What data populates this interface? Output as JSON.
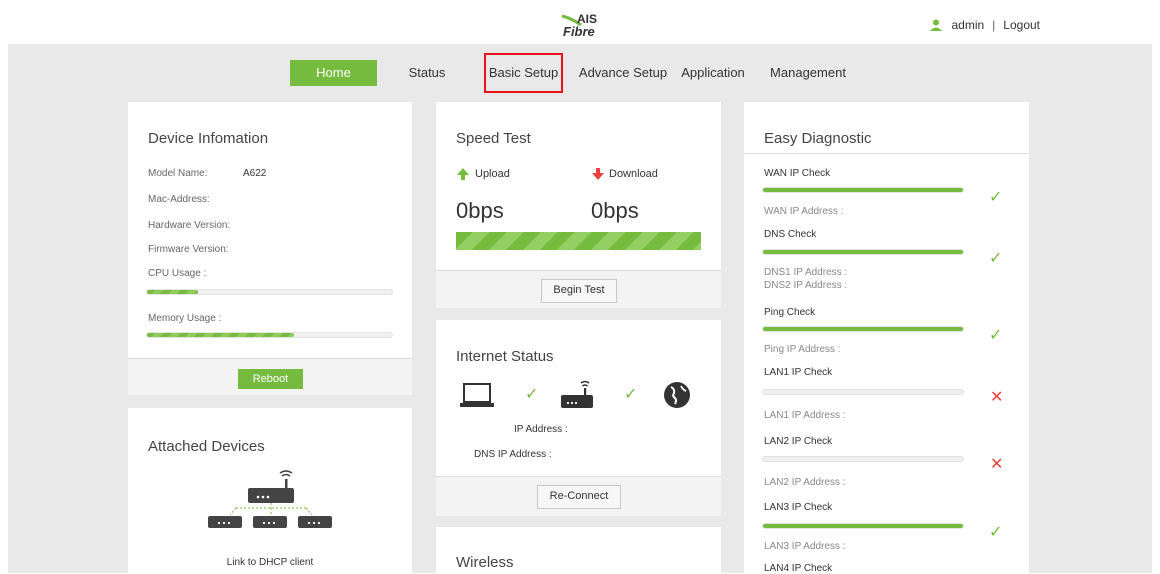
{
  "header": {
    "logo_top": "AIS",
    "logo_bottom": "Fibre",
    "user": "admin",
    "separator": "|",
    "logout": "Logout"
  },
  "nav": {
    "home": "Home",
    "status": "Status",
    "basic_setup": "Basic Setup",
    "advance_setup": "Advance Setup",
    "application": "Application",
    "management": "Management"
  },
  "device_info": {
    "title": "Device Infomation",
    "model_label": "Model Name:",
    "model_value": "A622",
    "mac_label": "Mac-Address:",
    "hw_label": "Hardware Version:",
    "fw_label": "Firmware Version:",
    "cpu_label": "CPU Usage :",
    "cpu_usage": 0.21,
    "mem_label": "Memory Usage :",
    "mem_usage": 0.6,
    "reboot": "Reboot"
  },
  "attached": {
    "title": "Attached Devices",
    "caption": "Link to DHCP client"
  },
  "speed_test": {
    "title": "Speed Test",
    "upload_label": "Upload",
    "download_label": "Download",
    "upload_value": "0bps",
    "download_value": "0bps",
    "begin": "Begin Test"
  },
  "internet_status": {
    "title": "Internet Status",
    "ip_label": "IP Address :",
    "dns_label": "DNS IP Address :",
    "reconnect": "Re-Connect"
  },
  "wireless": {
    "title": "Wireless"
  },
  "diagnostic": {
    "title": "Easy Diagnostic",
    "wan_check": "WAN IP Check",
    "wan_ip": "WAN IP Address :",
    "dns_check": "DNS Check",
    "dns1": "DNS1 IP Address :",
    "dns2": "DNS2 IP Address :",
    "ping_check": "Ping Check",
    "ping_ip": "Ping IP Address :",
    "lan1_check": "LAN1 IP Check",
    "lan1_ip": "LAN1 IP Address :",
    "lan2_check": "LAN2 IP Check",
    "lan2_ip": "LAN2 IP Address :",
    "lan3_check": "LAN3 IP Check",
    "lan3_ip": "LAN3 IP Address :",
    "lan4_check": "LAN4 IP Check",
    "ok_mark": "✓",
    "fail_mark": "✕"
  },
  "colors": {
    "accent": "#74bb3e",
    "highlight": "#e5141b",
    "fail": "#e8423a",
    "background": "#e9e9e9"
  }
}
